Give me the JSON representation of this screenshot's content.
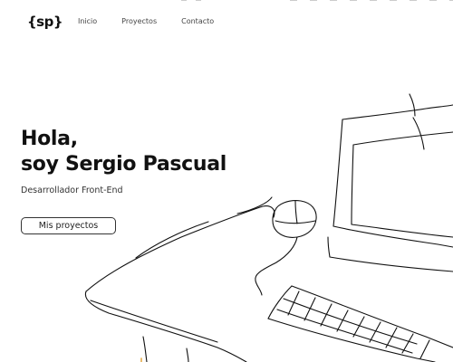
{
  "header": {
    "logo_text": "{sp}",
    "nav": [
      {
        "label": "Inicio"
      },
      {
        "label": "Proyectos"
      },
      {
        "label": "Contacto"
      }
    ]
  },
  "hero": {
    "title_line1": "Hola,",
    "title_line2": "soy Sergio Pascual",
    "subtitle": "Desarrollador Front-End",
    "cta_label": "Mis proyectos"
  },
  "illustration": {
    "icon": "desk-computer-sketch-icon",
    "stroke_color": "#111111"
  }
}
